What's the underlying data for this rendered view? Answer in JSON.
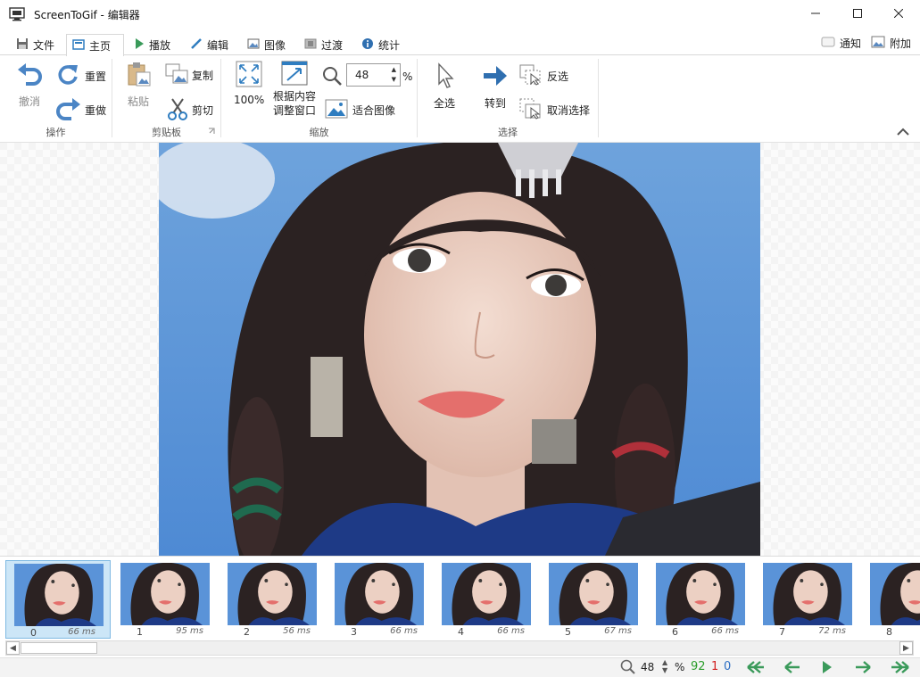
{
  "window": {
    "title": "ScreenToGif - 编辑器"
  },
  "tabs": [
    {
      "label": "文件",
      "icon": "floppy-icon"
    },
    {
      "label": "主页",
      "icon": "home-icon"
    },
    {
      "label": "播放",
      "icon": "play-icon"
    },
    {
      "label": "编辑",
      "icon": "pencil-icon"
    },
    {
      "label": "图像",
      "icon": "image-icon"
    },
    {
      "label": "过渡",
      "icon": "transition-icon"
    },
    {
      "label": "统计",
      "icon": "info-icon"
    }
  ],
  "tabs_right": [
    {
      "label": "通知",
      "icon": "notification-icon"
    },
    {
      "label": "附加",
      "icon": "extras-icon"
    }
  ],
  "ribbon": {
    "action": {
      "label": "操作",
      "undo": "撤消",
      "redo": "重置",
      "reset": "重做"
    },
    "clipboard": {
      "label": "剪贴板",
      "paste": "粘贴",
      "copy": "复制",
      "cut": "剪切"
    },
    "zoom": {
      "label": "缩放",
      "full": "100%",
      "fit_content_line1": "根据内容",
      "fit_content_line2": "调整窗口",
      "zoom_value": "48",
      "percent": "%",
      "fit_image": "适合图像"
    },
    "select": {
      "label": "选择",
      "select_all": "全选",
      "goto": "转到",
      "invert": "反选",
      "deselect": "取消选择"
    }
  },
  "frames": [
    {
      "num": "0",
      "dur": "66 ms"
    },
    {
      "num": "1",
      "dur": "95 ms"
    },
    {
      "num": "2",
      "dur": "56 ms"
    },
    {
      "num": "3",
      "dur": "66 ms"
    },
    {
      "num": "4",
      "dur": "66 ms"
    },
    {
      "num": "5",
      "dur": "67 ms"
    },
    {
      "num": "6",
      "dur": "66 ms"
    },
    {
      "num": "7",
      "dur": "72 ms"
    },
    {
      "num": "8",
      "dur": ""
    }
  ],
  "status": {
    "zoom": "48",
    "percent": "%",
    "total": "92",
    "selected": "1",
    "current": "0"
  },
  "colors": {
    "accent": "#2f7dc0",
    "total": "#2a9d2a",
    "selected": "#d22020",
    "current": "#2d6fc4",
    "nav": "#3a9a5a"
  }
}
